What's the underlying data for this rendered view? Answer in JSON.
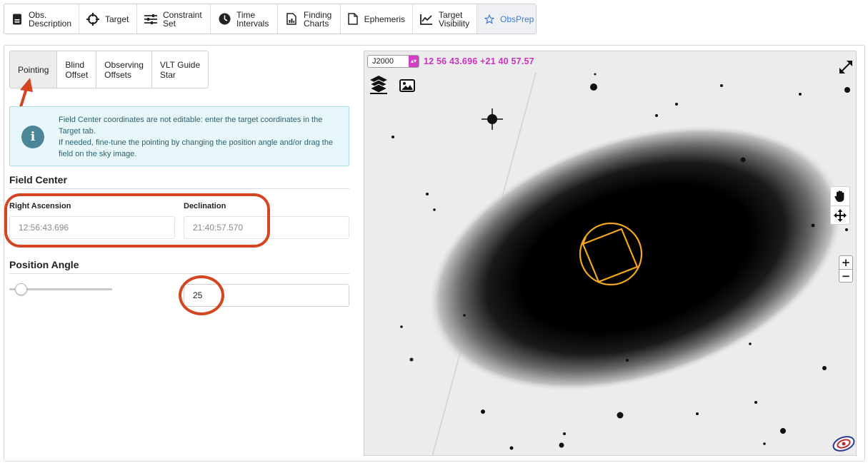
{
  "top_tabs": [
    {
      "label": "Obs.\nDescription",
      "icon": "document-icon"
    },
    {
      "label": "Target",
      "icon": "crosshair-icon"
    },
    {
      "label": "Constraint\nSet",
      "icon": "sliders-icon"
    },
    {
      "label": "Time\nIntervals",
      "icon": "clock-icon"
    },
    {
      "label": "Finding\nCharts",
      "icon": "chart-file-icon"
    },
    {
      "label": "Ephemeris",
      "icon": "file-icon"
    },
    {
      "label": "Target\nVisibility",
      "icon": "line-chart-icon"
    },
    {
      "label": "ObsPrep",
      "icon": "star-icon",
      "active": true
    }
  ],
  "sub_tabs": [
    {
      "label": "Pointing",
      "active": true
    },
    {
      "label": "Blind\nOffset"
    },
    {
      "label": "Observing\nOffsets"
    },
    {
      "label": "VLT Guide\nStar"
    }
  ],
  "info": {
    "text1": "Field Center coordinates are not editable: enter the target coordinates in the Target tab.",
    "text2": "If needed, fine-tune the pointing by changing the position angle and/or drag the field on the sky image."
  },
  "field_center": {
    "title": "Field Center",
    "ra_label": "Right Ascension",
    "ra_value": "12:56:43.696",
    "dec_label": "Declination",
    "dec_value": "21:40:57.570"
  },
  "position_angle": {
    "title": "Position Angle",
    "value": "25"
  },
  "sky": {
    "frame_option": "J2000",
    "coordinates": "12 56 43.696 +21 40 57.57"
  },
  "colors": {
    "accent": "#3b7bd6",
    "annotation": "#d44521",
    "coord_text": "#c735be",
    "fov_outline": "#f5a623"
  }
}
